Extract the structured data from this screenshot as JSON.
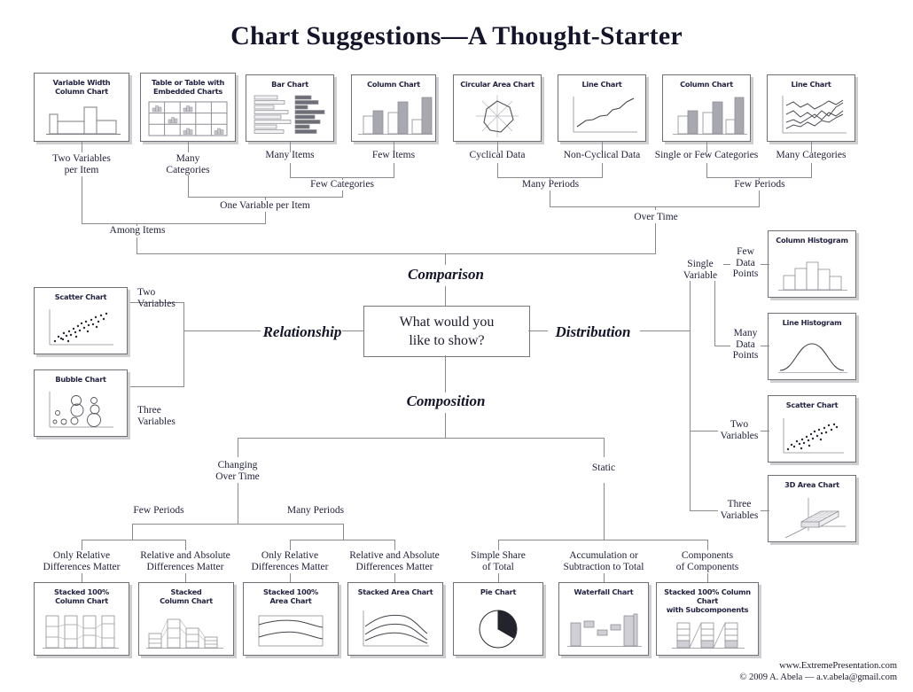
{
  "title": "Chart Suggestions—A Thought-Starter",
  "hub": {
    "line1": "What would you",
    "line2": "like to show?"
  },
  "categories": {
    "comparison": "Comparison",
    "relationship": "Relationship",
    "distribution": "Distribution",
    "composition": "Composition"
  },
  "cards": {
    "variable_width_column": {
      "l1": "Variable Width",
      "l2": "Column Chart"
    },
    "table_embedded": {
      "l1": "Table or Table with",
      "l2": "Embedded Charts"
    },
    "bar_chart": {
      "l1": "Bar Chart",
      "l2": ""
    },
    "column_chart_few": {
      "l1": "Column Chart",
      "l2": ""
    },
    "circular_area": {
      "l1": "Circular Area Chart",
      "l2": ""
    },
    "line_chart_noncyc": {
      "l1": "Line Chart",
      "l2": ""
    },
    "column_chart_single": {
      "l1": "Column Chart",
      "l2": ""
    },
    "line_chart_many": {
      "l1": "Line Chart",
      "l2": ""
    },
    "scatter_rel": {
      "l1": "Scatter Chart",
      "l2": ""
    },
    "bubble": {
      "l1": "Bubble Chart",
      "l2": ""
    },
    "column_histogram": {
      "l1": "Column Histogram",
      "l2": ""
    },
    "line_histogram": {
      "l1": "Line Histogram",
      "l2": ""
    },
    "scatter_dist": {
      "l1": "Scatter Chart",
      "l2": ""
    },
    "area_3d": {
      "l1": "3D Area Chart",
      "l2": ""
    },
    "stacked_100_column": {
      "l1": "Stacked 100%",
      "l2": "Column Chart"
    },
    "stacked_column": {
      "l1": "Stacked",
      "l2": "Column Chart"
    },
    "stacked_100_area": {
      "l1": "Stacked 100%",
      "l2": "Area Chart"
    },
    "stacked_area": {
      "l1": "Stacked Area Chart",
      "l2": ""
    },
    "pie": {
      "l1": "Pie Chart",
      "l2": ""
    },
    "waterfall": {
      "l1": "Waterfall Chart",
      "l2": ""
    },
    "stacked_sub": {
      "l1": "Stacked 100% Column Chart",
      "l2": "with Subcomponents"
    }
  },
  "branch_labels": {
    "two_variables_per_item": "Two Variables\nper Item",
    "many_categories_top": "Many\nCategories",
    "many_items": "Many Items",
    "few_items": "Few Items",
    "few_categories": "Few Categories",
    "one_variable_per_item": "One Variable per Item",
    "among_items": "Among Items",
    "cyclical_data": "Cyclical Data",
    "non_cyclical_data": "Non-Cyclical Data",
    "single_or_few_categories": "Single or Few Categories",
    "many_categories_right": "Many Categories",
    "many_periods_top": "Many Periods",
    "few_periods_top": "Few Periods",
    "over_time": "Over Time",
    "two_variables_rel": "Two\nVariables",
    "three_variables_rel": "Three\nVariables",
    "single_variable": "Single\nVariable",
    "few_data_points": "Few\nData\nPoints",
    "many_data_points": "Many\nData\nPoints",
    "two_variables_dist": "Two\nVariables",
    "three_variables_dist": "Three\nVariables",
    "changing_over_time": "Changing\nOver Time",
    "static": "Static",
    "few_periods_comp": "Few Periods",
    "many_periods_comp": "Many Periods",
    "only_relative_1": "Only Relative\nDifferences Matter",
    "relative_absolute_1": "Relative and Absolute\nDifferences Matter",
    "only_relative_2": "Only Relative\nDifferences Matter",
    "relative_absolute_2": "Relative and Absolute\nDifferences Matter",
    "simple_share": "Simple Share\nof Total",
    "accumulation": "Accumulation or\nSubtraction to Total",
    "components": "Components\nof Components"
  },
  "footer": {
    "site": "www.ExtremePresentation.com",
    "credit": "© 2009  A. Abela — a.v.abela@gmail.com"
  },
  "chart_data": {
    "type": "diagram",
    "title": "Chart Suggestions—A Thought-Starter",
    "root": "What would you like to show?",
    "branches": [
      {
        "name": "Comparison",
        "children": [
          {
            "name": "Among Items",
            "children": [
              {
                "name": "Two Variables per Item",
                "charts": [
                  "Variable Width Column Chart"
                ]
              },
              {
                "name": "One Variable per Item",
                "children": [
                  {
                    "name": "Many Categories",
                    "charts": [
                      "Table or Table with Embedded Charts"
                    ]
                  },
                  {
                    "name": "Few Categories",
                    "children": [
                      {
                        "name": "Many Items",
                        "charts": [
                          "Bar Chart"
                        ]
                      },
                      {
                        "name": "Few Items",
                        "charts": [
                          "Column Chart"
                        ]
                      }
                    ]
                  }
                ]
              }
            ]
          },
          {
            "name": "Over Time",
            "children": [
              {
                "name": "Many Periods",
                "children": [
                  {
                    "name": "Cyclical Data",
                    "charts": [
                      "Circular Area Chart"
                    ]
                  },
                  {
                    "name": "Non-Cyclical Data",
                    "charts": [
                      "Line Chart"
                    ]
                  }
                ]
              },
              {
                "name": "Few Periods",
                "children": [
                  {
                    "name": "Single or Few Categories",
                    "charts": [
                      "Column Chart"
                    ]
                  },
                  {
                    "name": "Many Categories",
                    "charts": [
                      "Line Chart"
                    ]
                  }
                ]
              }
            ]
          }
        ]
      },
      {
        "name": "Relationship",
        "children": [
          {
            "name": "Two Variables",
            "charts": [
              "Scatter Chart"
            ]
          },
          {
            "name": "Three Variables",
            "charts": [
              "Bubble Chart"
            ]
          }
        ]
      },
      {
        "name": "Distribution",
        "children": [
          {
            "name": "Single Variable",
            "children": [
              {
                "name": "Few Data Points",
                "charts": [
                  "Column Histogram"
                ]
              },
              {
                "name": "Many Data Points",
                "charts": [
                  "Line Histogram"
                ]
              }
            ]
          },
          {
            "name": "Two Variables",
            "charts": [
              "Scatter Chart"
            ]
          },
          {
            "name": "Three Variables",
            "charts": [
              "3D Area Chart"
            ]
          }
        ]
      },
      {
        "name": "Composition",
        "children": [
          {
            "name": "Changing Over Time",
            "children": [
              {
                "name": "Few Periods",
                "children": [
                  {
                    "name": "Only Relative Differences Matter",
                    "charts": [
                      "Stacked 100% Column Chart"
                    ]
                  },
                  {
                    "name": "Relative and Absolute Differences Matter",
                    "charts": [
                      "Stacked Column Chart"
                    ]
                  }
                ]
              },
              {
                "name": "Many Periods",
                "children": [
                  {
                    "name": "Only Relative Differences Matter",
                    "charts": [
                      "Stacked 100% Area Chart"
                    ]
                  },
                  {
                    "name": "Relative and Absolute Differences Matter",
                    "charts": [
                      "Stacked Area Chart"
                    ]
                  }
                ]
              }
            ]
          },
          {
            "name": "Static",
            "children": [
              {
                "name": "Simple Share of Total",
                "charts": [
                  "Pie Chart"
                ]
              },
              {
                "name": "Accumulation or Subtraction to Total",
                "charts": [
                  "Waterfall Chart"
                ]
              },
              {
                "name": "Components of Components",
                "charts": [
                  "Stacked 100% Column Chart with Subcomponents"
                ]
              }
            ]
          }
        ]
      }
    ]
  }
}
